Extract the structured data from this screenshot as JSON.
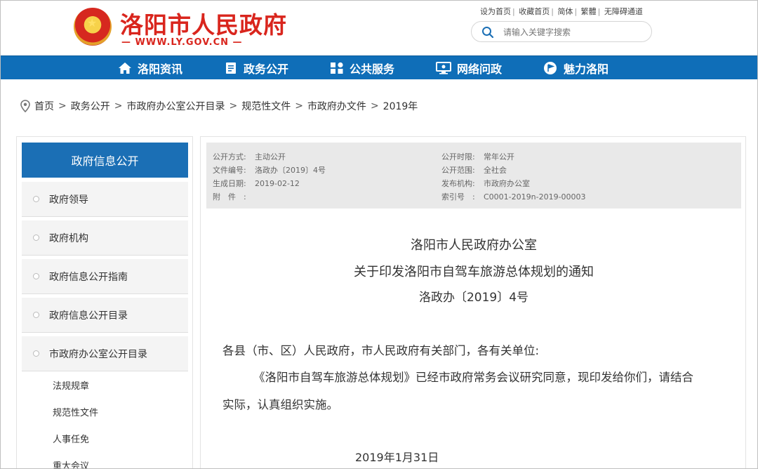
{
  "header": {
    "site_title": "洛阳市人民政府",
    "site_url": "— WWW.LY.GOV.CN —",
    "top_links": [
      "设为首页",
      "收藏首页",
      "简体",
      "繁體",
      "无障碍通道"
    ],
    "search_placeholder": "请输入关键字搜索"
  },
  "nav": {
    "items": [
      {
        "label": "洛阳资讯",
        "icon": "home-icon"
      },
      {
        "label": "政务公开",
        "icon": "document-icon"
      },
      {
        "label": "公共服务",
        "icon": "grid-icon"
      },
      {
        "label": "网络问政",
        "icon": "monitor-icon"
      },
      {
        "label": "魅力洛阳",
        "icon": "flag-icon"
      }
    ]
  },
  "breadcrumb": [
    "首页",
    "政务公开",
    "市政府办公室公开目录",
    "规范性文件",
    "市政府办文件",
    "2019年"
  ],
  "sidebar": {
    "header": "政府信息公开",
    "items": [
      "政府领导",
      "政府机构",
      "政府信息公开指南",
      "政府信息公开目录",
      "市政府办公室公开目录"
    ],
    "sub_items": [
      "法规规章",
      "规范性文件",
      "人事任免",
      "重大会议"
    ]
  },
  "meta": {
    "left": [
      {
        "label": "公开方式:",
        "value": "主动公开"
      },
      {
        "label": "文件编号:",
        "value": "洛政办〔2019〕4号"
      },
      {
        "label": "生成日期:",
        "value": "2019-02-12"
      },
      {
        "label": "附　件　:",
        "value": ""
      }
    ],
    "right": [
      {
        "label": "公开时限:",
        "value": "常年公开"
      },
      {
        "label": "公开范围:",
        "value": "全社会"
      },
      {
        "label": "发布机构:",
        "value": "市政府办公室"
      },
      {
        "label": "索引号　:",
        "value": "C0001-2019n-2019-00003"
      }
    ]
  },
  "document": {
    "title_line1": "洛阳市人民政府办公室",
    "title_line2": "关于印发洛阳市自驾车旅游总体规划的通知",
    "doc_number": "洛政办〔2019〕4号",
    "salutation": "各县（市、区）人民政府，市人民政府有关部门，各有关单位:",
    "paragraph_line1": "《洛阳市自驾车旅游总体规划》已经市政府常务会议研究同意，现印发给你们，请结合",
    "paragraph_line2": "实际，认真组织实施。",
    "date": "2019年1月31日"
  }
}
